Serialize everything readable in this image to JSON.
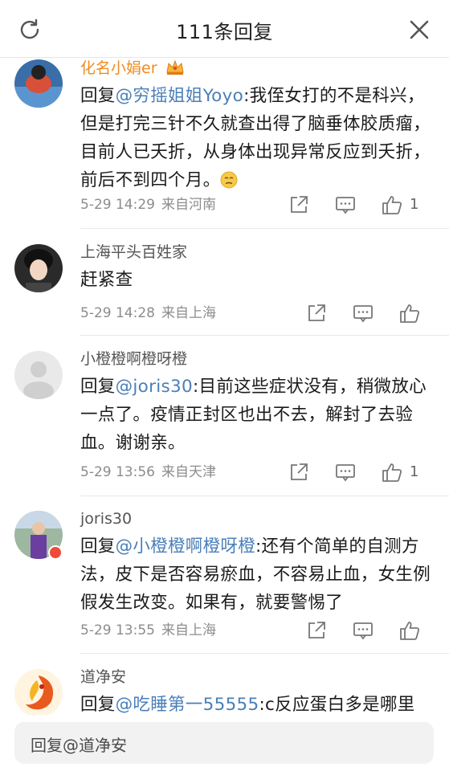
{
  "header": {
    "title": "111条回复",
    "refresh_icon": "refresh-icon",
    "close_icon": "close-icon"
  },
  "comments": [
    {
      "name": "化名小娟er",
      "reply_prefix": "回复",
      "mention": "@穷摇姐姐Yoyo",
      "text": ":我侄女打的不是科兴，但是打完三针不久就查出得了脑垂体胶质瘤，目前人已夭折，从身体出现异常反应到夭折，前后不到四个月。",
      "emoji": "sad-face-icon",
      "time": "5-29 14:29",
      "location": "来自河南",
      "likes": "1"
    },
    {
      "name": "上海平头百姓家",
      "text": "赶紧查",
      "time": "5-29 14:28",
      "location": "来自上海",
      "likes": ""
    },
    {
      "name": "小橙橙啊橙呀橙",
      "reply_prefix": "回复",
      "mention": "@joris30",
      "text": ":目前这些症状没有，稍微放心一点了。疫情正封区也出不去，解封了去验血。谢谢亲。",
      "time": "5-29 13:56",
      "location": "来自天津",
      "likes": "1"
    },
    {
      "name": "joris30",
      "reply_prefix": "回复",
      "mention": "@小橙橙啊橙呀橙",
      "text": ":还有个简单的自测方法，皮下是否容易瘀血，不容易止血，女生例假发生改变。如果有，就要警惕了",
      "time": "5-29 13:55",
      "location": "来自上海",
      "likes": ""
    },
    {
      "name": "道净安",
      "reply_prefix": "回复",
      "mention": "@吃睡第一55555",
      "text": ":c反应蛋白多是哪里",
      "time": "",
      "location": "",
      "likes": ""
    }
  ],
  "reply_box": {
    "placeholder": "回复@道净安"
  },
  "colors": {
    "mention": "#4a7fb8",
    "vip_name": "#f08a1f",
    "meta": "#8c8c8c",
    "verified_badge": "#f04a3a"
  }
}
